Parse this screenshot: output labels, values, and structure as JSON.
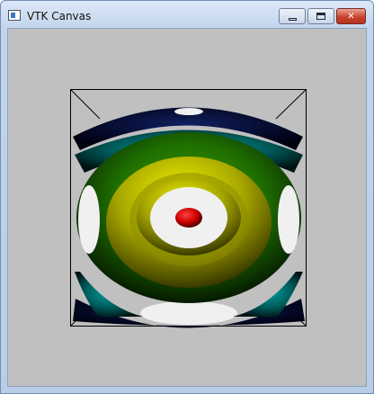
{
  "window": {
    "title": "VTK Canvas",
    "icon": "vtk-canvas-app-icon"
  },
  "title_buttons": {
    "minimize_icon": "minimize-icon",
    "maximize_icon": "maximize-icon",
    "close_icon": "close-icon",
    "close_glyph": "✕"
  },
  "canvas": {
    "background": "#c0c0c0",
    "outline_color": "#000000",
    "colors": {
      "center": "#d40000",
      "inner": "#c8c800",
      "middle": "#2e8a00",
      "outer": "#004848",
      "outermost": "#000026"
    }
  }
}
